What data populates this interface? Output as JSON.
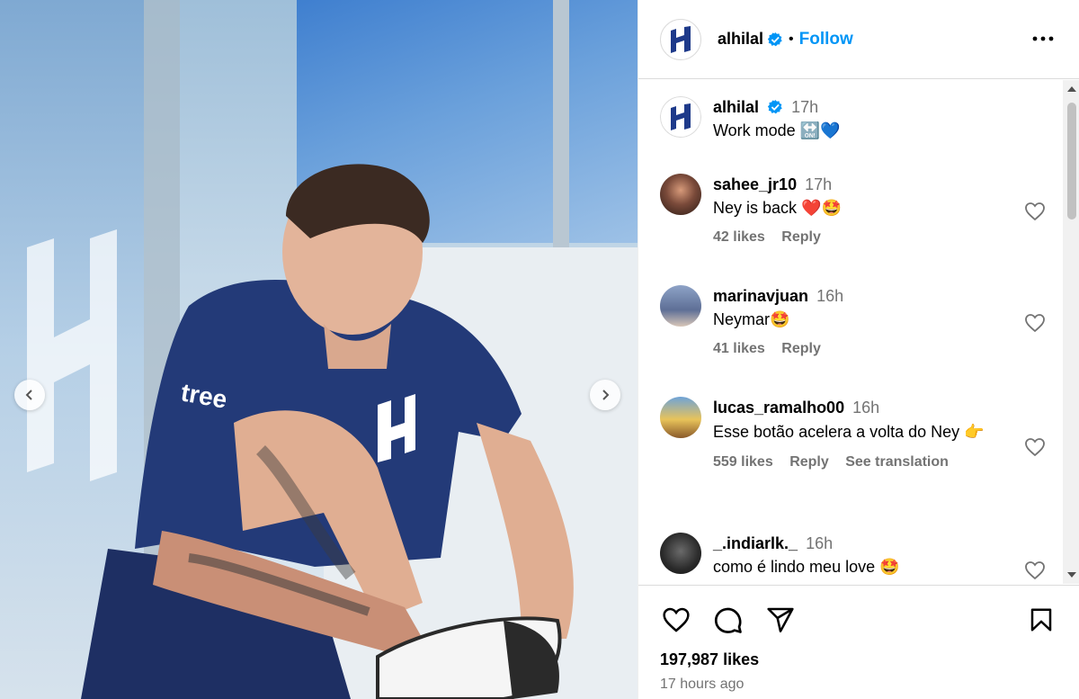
{
  "post": {
    "author": "alhilal",
    "follow_label": "Follow",
    "separator": "•",
    "caption": {
      "username": "alhilal",
      "time": "17h",
      "text": "Work mode 🔛💙"
    }
  },
  "comments": [
    {
      "username": "sahee_jr10",
      "time": "17h",
      "text": "Ney is back ❤️🤩",
      "likes": "42 likes",
      "reply": "Reply"
    },
    {
      "username": "marinavjuan",
      "time": "16h",
      "text": "Neymar🤩",
      "likes": "41 likes",
      "reply": "Reply"
    },
    {
      "username": "lucas_ramalho00",
      "time": "16h",
      "text": "Esse botão acelera a volta do Ney 👉",
      "likes": "559 likes",
      "reply": "Reply",
      "translate": "See translation"
    },
    {
      "username": "_.indiarlk._",
      "time": "16h",
      "text": "como é lindo meu love 🤩"
    }
  ],
  "footer": {
    "likes": "197,987 likes",
    "posted": "17 hours ago"
  },
  "icons": [
    "verified-badge-icon",
    "more-options-icon",
    "heart-icon",
    "comment-icon",
    "share-icon",
    "bookmark-icon",
    "chevron-left-icon",
    "chevron-right-icon"
  ],
  "colors": {
    "accent": "#0095f6",
    "verified": "#0095f6",
    "muted": "#737373",
    "brand": "#1e3a8a"
  }
}
